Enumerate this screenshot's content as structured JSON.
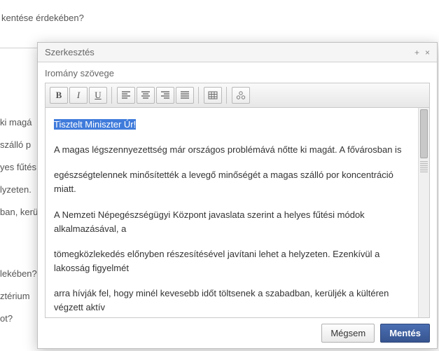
{
  "background": {
    "top_fragment": "kentése érdekében?",
    "lines": [
      "ki magá",
      "szálló p",
      "yes fűtés",
      "lyzeten.",
      "ban, kerü",
      "lekében?",
      "ztérium",
      "ot?"
    ]
  },
  "dialog": {
    "title": "Szerkesztés",
    "field_label": "Iromány szövege",
    "toolbar": {
      "bold": "B",
      "italic": "I",
      "underline": "U"
    },
    "content": {
      "selected": "Tisztelt Miniszter Úr!",
      "p1": "A magas légszennyezettség már országos problémává nőtte ki magát. A fővárosban is",
      "p2": "egészségtelennek minősítették a levegő minőségét a magas szálló por koncentráció miatt.",
      "p3": "A Nemzeti Népegészségügyi Központ javaslata szerint a helyes fűtési módok alkalmazásával, a",
      "p4": "tömegközlekedés előnyben részesítésével javítani lehet a helyzeten. Ezenkívül a lakosság figyelmét",
      "p5": "arra hívják fel, hogy minél kevesebb időt töltsenek a szabadban, kerüljék a kültéren végzett aktív"
    },
    "buttons": {
      "cancel": "Mégsem",
      "save": "Mentés"
    }
  }
}
